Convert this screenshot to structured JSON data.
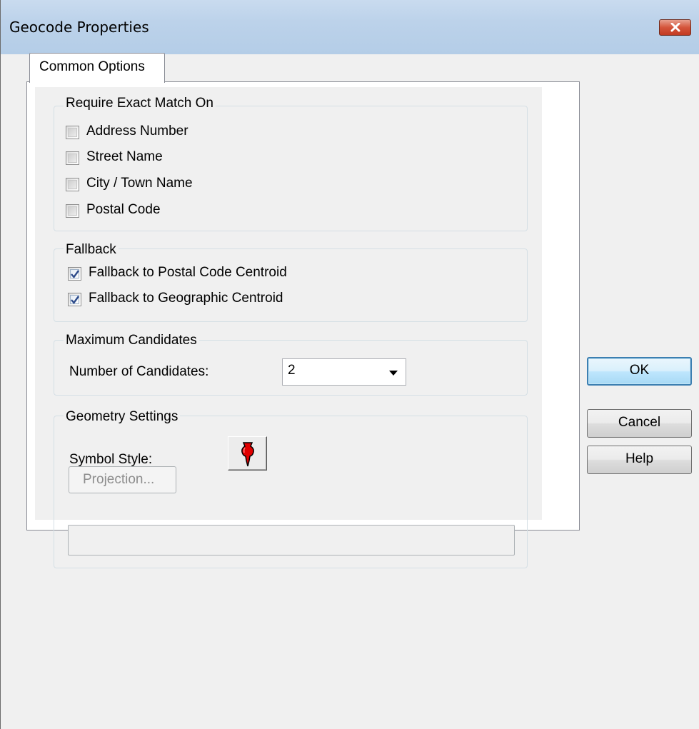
{
  "window": {
    "title": "Geocode Properties",
    "close_icon": "close-icon"
  },
  "tabs": [
    {
      "label": "Common Options",
      "selected": true
    }
  ],
  "exact_match": {
    "title": "Require Exact Match On",
    "options": [
      {
        "label": "Address Number",
        "checked": false
      },
      {
        "label": "Street Name",
        "checked": false
      },
      {
        "label": "City / Town Name",
        "checked": false
      },
      {
        "label": "Postal Code",
        "checked": false
      }
    ]
  },
  "fallback": {
    "title": "Fallback",
    "options": [
      {
        "label": "Fallback to Postal Code Centroid",
        "checked": true
      },
      {
        "label": "Fallback to Geographic Centroid",
        "checked": true
      }
    ]
  },
  "max_candidates": {
    "title": "Maximum Candidates",
    "label": "Number of Candidates:",
    "value": "2"
  },
  "geometry": {
    "title": "Geometry Settings",
    "symbol_label": "Symbol Style:",
    "symbol_icon": "red-pushpin-icon",
    "symbol_color": "#e00000",
    "projection_label": "Projection...",
    "projection_value": ""
  },
  "buttons": {
    "ok": "OK",
    "cancel": "Cancel",
    "help": "Help"
  }
}
